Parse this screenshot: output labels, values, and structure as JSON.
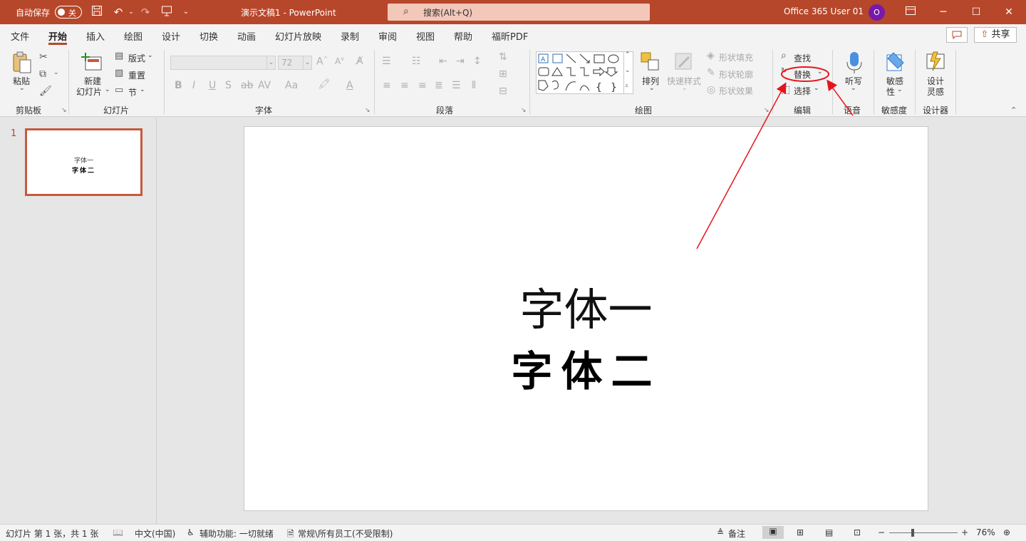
{
  "titlebar": {
    "autosave_label": "自动保存",
    "autosave_state": "关",
    "doc_title": "演示文稿1  -  PowerPoint",
    "search_placeholder": "搜索(Alt+Q)",
    "user_name": "Office 365 User 01",
    "avatar_initial": "O"
  },
  "tabs": [
    "文件",
    "开始",
    "插入",
    "绘图",
    "设计",
    "切换",
    "动画",
    "幻灯片放映",
    "录制",
    "审阅",
    "视图",
    "帮助",
    "福昕PDF"
  ],
  "active_tab": "开始",
  "share_label": "共享",
  "ribbon": {
    "clipboard": {
      "paste": "粘贴",
      "group": "剪贴板"
    },
    "slides": {
      "new_slide_1": "新建",
      "new_slide_2": "幻灯片",
      "layout": "版式",
      "reset": "重置",
      "section": "节",
      "group": "幻灯片"
    },
    "font": {
      "font_size": "72",
      "group": "字体"
    },
    "paragraph": {
      "group": "段落"
    },
    "drawing": {
      "arrange": "排列",
      "quick_styles": "快速样式",
      "shape_fill": "形状填充",
      "shape_outline": "形状轮廓",
      "shape_effects": "形状效果",
      "group": "绘图"
    },
    "editing": {
      "find": "查找",
      "replace": "替换",
      "select": "选择",
      "group": "编辑"
    },
    "voice": {
      "dictate": "听写",
      "group": "语音"
    },
    "sensitivity": {
      "label_1": "敏感",
      "label_2": "性",
      "group": "敏感度"
    },
    "designer": {
      "label_1": "设计",
      "label_2": "灵感",
      "group": "设计器"
    }
  },
  "slides_pane": {
    "slide_number": "1",
    "thumb_line1": "字体一",
    "thumb_line2": "字体二"
  },
  "slide": {
    "line1": "字体一",
    "line2": "字体二"
  },
  "statusbar": {
    "slide_info": "幻灯片 第 1 张，共 1 张",
    "language": "中文(中国)",
    "accessibility": "辅助功能: 一切就绪",
    "sensitivity": "常规\\所有员工(不受限制)",
    "notes": "备注",
    "zoom": "76%"
  },
  "colors": {
    "accent": "#b7472a",
    "annotation": "#e8141b"
  }
}
